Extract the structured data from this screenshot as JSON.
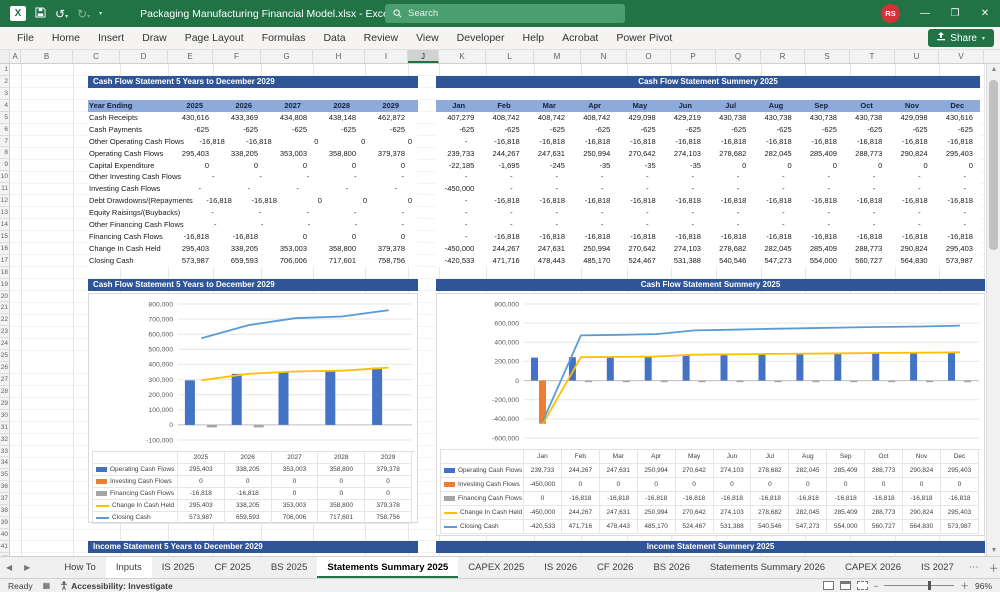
{
  "titlebar": {
    "title": "Packaging Manufacturing Financial Model.xlsx  -  Excel",
    "search_placeholder": "Search",
    "avatar_initials": "RS"
  },
  "ribbon": {
    "tabs": [
      "File",
      "Home",
      "Insert",
      "Draw",
      "Page Layout",
      "Formulas",
      "Data",
      "Review",
      "View",
      "Developer",
      "Help",
      "Acrobat",
      "Power Pivot"
    ],
    "share_label": "Share"
  },
  "sheet": {
    "column_letters": [
      "A",
      "B",
      "C",
      "D",
      "E",
      "F",
      "G",
      "H",
      "I",
      "J",
      "K",
      "L",
      "M",
      "N",
      "O",
      "P",
      "Q",
      "R",
      "S",
      "T",
      "U",
      "V"
    ],
    "selected_column": "J",
    "row_count": 42
  },
  "tables": {
    "annual": {
      "title": "Cash Flow Statement 5 Years to December 2029",
      "header_label": "Year Ending",
      "years": [
        "2025",
        "2026",
        "2027",
        "2028",
        "2029"
      ],
      "rows": [
        {
          "label": "Cash Receipts",
          "values": [
            "430,616",
            "433,369",
            "434,808",
            "438,148",
            "462,872"
          ]
        },
        {
          "label": "Cash Payments",
          "values": [
            "-625",
            "-625",
            "-625",
            "-625",
            "-625"
          ]
        },
        {
          "label": "Other Operating Cash Flows",
          "values": [
            "-16,818",
            "-16,818",
            "0",
            "0",
            "0"
          ]
        },
        {
          "label": "Operating Cash Flows",
          "values": [
            "295,403",
            "338,205",
            "353,003",
            "358,800",
            "379,378"
          ]
        },
        {
          "label": "Capital Expenditure",
          "values": [
            "0",
            "0",
            "0",
            "0",
            "0"
          ]
        },
        {
          "label": "Other Investing Cash Flows",
          "values": [
            "-",
            "-",
            "-",
            "-",
            "-"
          ]
        },
        {
          "label": "Investing Cash Flows",
          "values": [
            "-",
            "-",
            "-",
            "-",
            "-"
          ]
        },
        {
          "label": "Debt Drawdowns/(Repayments",
          "values": [
            "-16,818",
            "-16,818",
            "0",
            "0",
            "0"
          ]
        },
        {
          "label": "Equity Raisings/(Buybacks)",
          "values": [
            "-",
            "-",
            "-",
            "-",
            "-"
          ]
        },
        {
          "label": "Other Financing Cash Flows",
          "values": [
            "-",
            "-",
            "-",
            "-",
            "-"
          ]
        },
        {
          "label": "Financing Cash Flows",
          "values": [
            "-16,818",
            "-16,818",
            "0",
            "0",
            "0"
          ]
        },
        {
          "label": "Change In Cash Held",
          "values": [
            "295,403",
            "338,205",
            "353,003",
            "358,800",
            "379,378"
          ]
        },
        {
          "label": "Closing Cash",
          "values": [
            "573,987",
            "659,593",
            "706,006",
            "717,601",
            "758,756"
          ]
        }
      ]
    },
    "monthly": {
      "title": "Cash Flow Statement Summery 2025",
      "months": [
        "Jan",
        "Feb",
        "Mar",
        "Apr",
        "May",
        "Jun",
        "Jul",
        "Aug",
        "Sep",
        "Oct",
        "Nov",
        "Dec"
      ],
      "rows": [
        [
          "407,279",
          "408,742",
          "408,742",
          "408,742",
          "429,098",
          "429,219",
          "430,738",
          "430,738",
          "430,738",
          "430,738",
          "429,098",
          "430,616"
        ],
        [
          "-625",
          "-625",
          "-625",
          "-625",
          "-625",
          "-625",
          "-625",
          "-625",
          "-625",
          "-625",
          "-625",
          "-625"
        ],
        [
          "-",
          "-16,818",
          "-16,818",
          "-16,818",
          "-16,818",
          "-16,818",
          "-16,818",
          "-16,818",
          "-16,818",
          "-16,818",
          "-16,818",
          "-16,818"
        ],
        [
          "239,733",
          "244,267",
          "247,631",
          "250,994",
          "270,642",
          "274,103",
          "278,682",
          "282,045",
          "285,409",
          "288,773",
          "290,824",
          "295,403"
        ],
        [
          "-22,185",
          "-1,695",
          "-245",
          "-35",
          "-35",
          "-35",
          "0",
          "0",
          "0",
          "0",
          "0",
          "0"
        ],
        [
          "-",
          "-",
          "-",
          "-",
          "-",
          "-",
          "-",
          "-",
          "-",
          "-",
          "-",
          "-"
        ],
        [
          "-450,000",
          "-",
          "-",
          "-",
          "-",
          "-",
          "-",
          "-",
          "-",
          "-",
          "-",
          "-"
        ],
        [
          "-",
          "-16,818",
          "-16,818",
          "-16,818",
          "-16,818",
          "-16,818",
          "-16,818",
          "-16,818",
          "-16,818",
          "-16,818",
          "-16,818",
          "-16,818"
        ],
        [
          "-",
          "-",
          "-",
          "-",
          "-",
          "-",
          "-",
          "-",
          "-",
          "-",
          "-",
          "-"
        ],
        [
          "-",
          "-",
          "-",
          "-",
          "-",
          "-",
          "-",
          "-",
          "-",
          "-",
          "-",
          "-"
        ],
        [
          "-",
          "-16,818",
          "-16,818",
          "-16,818",
          "-16,818",
          "-16,818",
          "-16,818",
          "-16,818",
          "-16,818",
          "-16,818",
          "-16,818",
          "-16,818"
        ],
        [
          "-450,000",
          "244,267",
          "247,631",
          "250,994",
          "270,642",
          "274,103",
          "278,682",
          "282,045",
          "285,409",
          "288,773",
          "290,824",
          "295,403"
        ],
        [
          "-420,533",
          "471,716",
          "478,443",
          "485,170",
          "524,467",
          "531,388",
          "540,546",
          "547,273",
          "554,000",
          "560,727",
          "564,830",
          "573,987"
        ]
      ]
    }
  },
  "section_headers": {
    "income_left": "Income Statement 5 Years to December 2029",
    "income_right": "Income Statement Summery 2025"
  },
  "chart_data": [
    {
      "type": "bar",
      "title": "Cash Flow Statement 5 Years to December 2029",
      "categories": [
        "2025",
        "2026",
        "2027",
        "2028",
        "2029"
      ],
      "ylim": [
        -100000,
        800000
      ],
      "ystep": 100000,
      "legend_position": "table-left",
      "grid": true,
      "series": [
        {
          "name": "Operating Cash Flows",
          "kind": "bar",
          "color": "#4472C4",
          "values": [
            "295,403",
            "338,205",
            "353,003",
            "358,800",
            "379,378"
          ]
        },
        {
          "name": "Investing Cash Flows",
          "kind": "bar",
          "color": "#ED7D31",
          "values": [
            "0",
            "0",
            "0",
            "0",
            "0"
          ]
        },
        {
          "name": "Financing Cash Flows",
          "kind": "bar",
          "color": "#A5A5A5",
          "values": [
            "-16,818",
            "-16,818",
            "0",
            "0",
            "0"
          ]
        },
        {
          "name": "Change In Cash Held",
          "kind": "line",
          "color": "#FFC000",
          "values": [
            "295,403",
            "338,205",
            "353,003",
            "358,800",
            "379,378"
          ]
        },
        {
          "name": "Closing Cash",
          "kind": "line",
          "color": "#5B9BD5",
          "values": [
            "573,987",
            "659,593",
            "706,006",
            "717,601",
            "758,756"
          ]
        }
      ]
    },
    {
      "type": "bar",
      "title": "Cash Flow Statement Summery 2025",
      "categories": [
        "Jan",
        "Feb",
        "Mar",
        "Apr",
        "May",
        "Jun",
        "Jul",
        "Aug",
        "Sep",
        "Oct",
        "Nov",
        "Dec"
      ],
      "ylim": [
        -600000,
        800000
      ],
      "ystep": 200000,
      "legend_position": "table-left",
      "grid": true,
      "series": [
        {
          "name": "Operating Cash Flows",
          "kind": "bar",
          "color": "#4472C4",
          "values": [
            "239,733",
            "244,267",
            "247,631",
            "250,994",
            "270,642",
            "274,103",
            "278,682",
            "282,045",
            "285,409",
            "288,773",
            "290,824",
            "295,403"
          ]
        },
        {
          "name": "Investing Cash Flows",
          "kind": "bar",
          "color": "#ED7D31",
          "values": [
            "-450,000",
            "0",
            "0",
            "0",
            "0",
            "0",
            "0",
            "0",
            "0",
            "0",
            "0",
            "0"
          ]
        },
        {
          "name": "Financing Cash Flows",
          "kind": "bar",
          "color": "#A5A5A5",
          "values": [
            "0",
            "-16,818",
            "-16,818",
            "-16,818",
            "-16,818",
            "-16,818",
            "-16,818",
            "-16,818",
            "-16,818",
            "-16,818",
            "-16,818",
            "-16,818"
          ]
        },
        {
          "name": "Change In Cash Held",
          "kind": "line",
          "color": "#FFC000",
          "values": [
            "-450,000",
            "244,267",
            "247,631",
            "250,994",
            "270,642",
            "274,103",
            "278,682",
            "282,045",
            "285,409",
            "288,773",
            "290,824",
            "295,403"
          ]
        },
        {
          "name": "Closing Cash",
          "kind": "line",
          "color": "#5B9BD5",
          "values": [
            "-420,533",
            "471,716",
            "478,443",
            "485,170",
            "524,467",
            "531,388",
            "540,546",
            "547,273",
            "554,000",
            "560,727",
            "564,830",
            "573,987"
          ]
        }
      ]
    }
  ],
  "sheet_tabs": {
    "items": [
      "How To",
      "Inputs",
      "IS 2025",
      "CF 2025",
      "BS 2025",
      "Statements Summary 2025",
      "CAPEX 2025",
      "IS 2026",
      "CF 2026",
      "BS 2026",
      "Statements Summary 2026",
      "CAPEX 2026",
      "IS 2027"
    ],
    "active": "Statements Summary 2025",
    "boxed": "Inputs"
  },
  "statusbar": {
    "mode": "Ready",
    "accessibility": "Accessibility: Investigate",
    "zoom_level": "96%"
  },
  "colors": {
    "titlebar_green": "#217346",
    "header_blue": "#2F5597",
    "band_blue": "#8EAADB",
    "tab_underline_green": "#217346"
  }
}
